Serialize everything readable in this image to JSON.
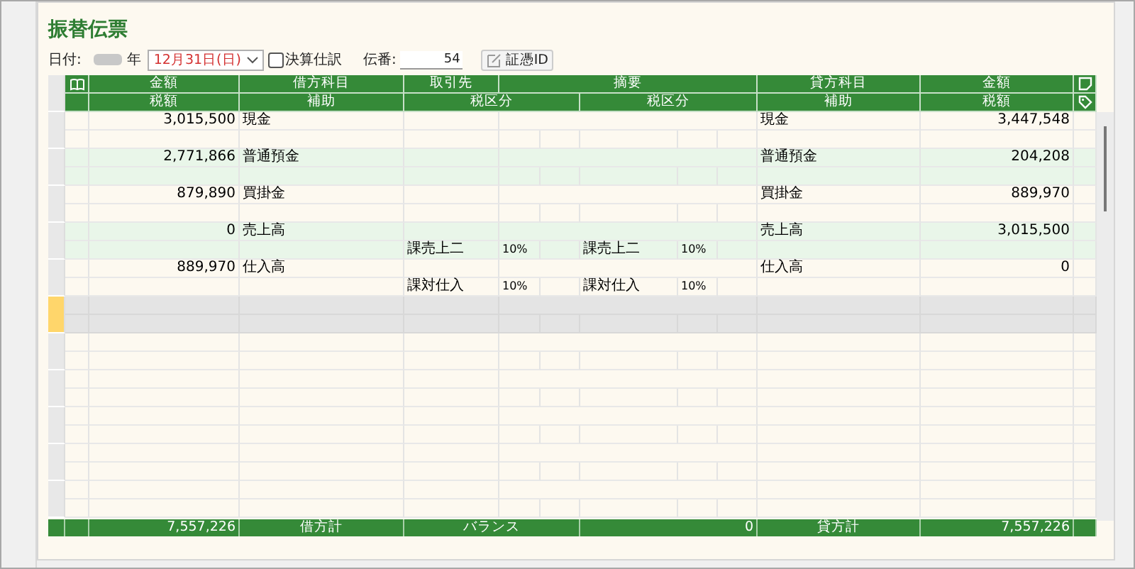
{
  "title": "振替伝票",
  "toolbar": {
    "date_label": "日付:",
    "year_suffix": "年",
    "date_value": "12月31日(日)",
    "closing_entry": {
      "label": "決算仕訳",
      "checked": false
    },
    "slip_label": "伝番:",
    "slip_number": "54",
    "evidence_button": "証憑ID"
  },
  "header": {
    "row1": [
      "金額",
      "借方科目",
      "取引先",
      "摘要",
      "貸方科目",
      "金額"
    ],
    "row2": [
      "税額",
      "補助",
      "税区分",
      "税区分",
      "補助",
      "税額"
    ]
  },
  "entries": [
    {
      "selected": false,
      "debit_amount": "3,015,500",
      "debit_account": "現金",
      "credit_account": "現金",
      "credit_amount": "3,447,548"
    },
    {
      "selected": false,
      "debit_amount": "2,771,866",
      "debit_account": "普通預金",
      "credit_account": "普通預金",
      "credit_amount": "204,208"
    },
    {
      "selected": false,
      "debit_amount": "879,890",
      "debit_account": "買掛金",
      "credit_account": "買掛金",
      "credit_amount": "889,970"
    },
    {
      "selected": false,
      "debit_amount": "0",
      "debit_account": "売上高",
      "debit_tax": "課売上二",
      "debit_rate": "10%",
      "credit_tax": "課売上二",
      "credit_rate": "10%",
      "credit_account": "売上高",
      "credit_amount": "3,015,500"
    },
    {
      "selected": false,
      "debit_amount": "889,970",
      "debit_account": "仕入高",
      "debit_tax": "課対仕入",
      "debit_rate": "10%",
      "credit_tax": "課対仕入",
      "credit_rate": "10%",
      "credit_account": "仕入高",
      "credit_amount": "0"
    },
    {
      "selected": true
    }
  ],
  "totals": {
    "debit_total": "7,557,226",
    "debit_label": "借方計",
    "balance_label": "バランス",
    "balance": "0",
    "credit_label": "貸方計",
    "credit_total": "7,557,226"
  }
}
